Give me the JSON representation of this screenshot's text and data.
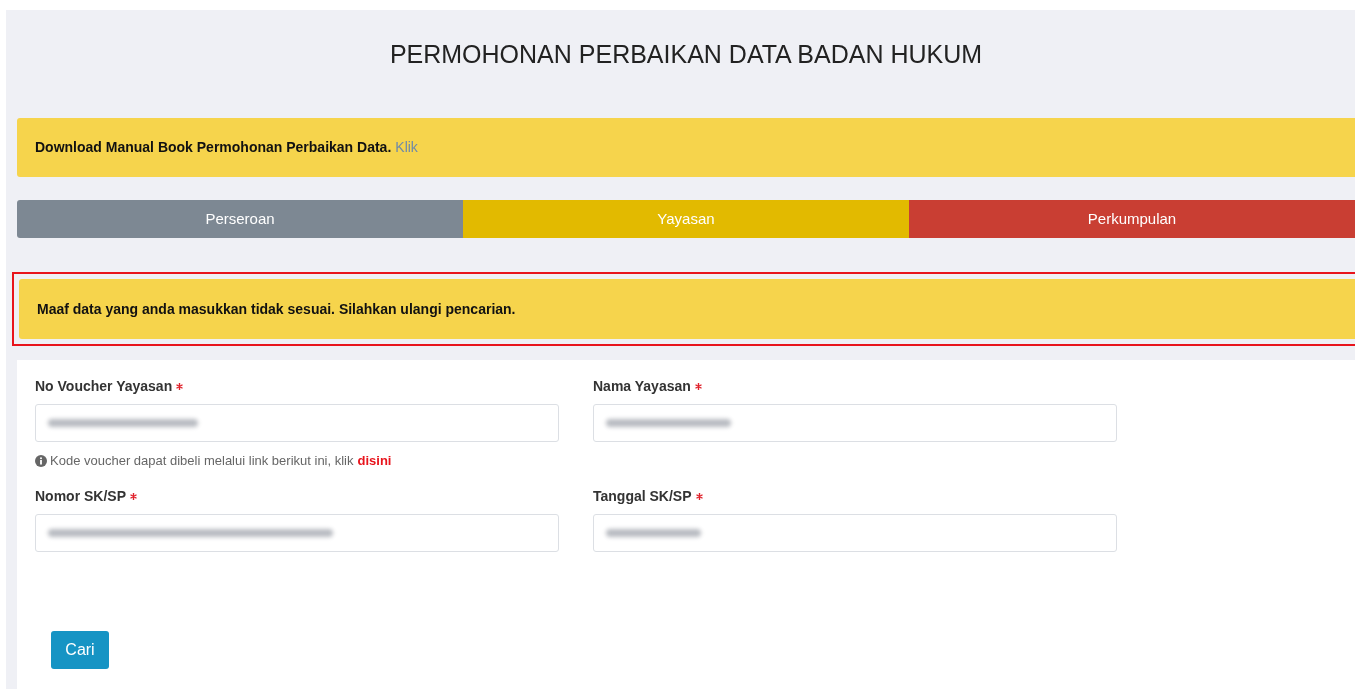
{
  "title": "PERMOHONAN PERBAIKAN DATA BADAN HUKUM",
  "notice": {
    "text": "Download Manual Book Permohonan Perbaikan Data.",
    "link": "Klik"
  },
  "tabs": [
    {
      "label": "Perseroan",
      "color": "#7d8893"
    },
    {
      "label": "Yayasan",
      "color": "#e2ba00"
    },
    {
      "label": "Perkumpulan",
      "color": "#c93e33"
    }
  ],
  "error": {
    "text": "Maaf data yang anda masukkan tidak sesuai. Silahkan ulangi pencarian.",
    "highlighted": true
  },
  "form": {
    "fields": [
      {
        "label": "No Voucher Yayasan",
        "required": true,
        "value_hidden": true,
        "hint": {
          "text": "Kode voucher dapat dibeli melalui link berikut ini, klik",
          "link": "disini"
        }
      },
      {
        "label": "Nama Yayasan",
        "required": true,
        "value_hidden": true
      },
      {
        "label": "Nomor SK/SP",
        "required": true,
        "value_hidden": true
      },
      {
        "label": "Tanggal SK/SP",
        "required": true,
        "value_hidden": true
      }
    ],
    "button": "Cari"
  }
}
